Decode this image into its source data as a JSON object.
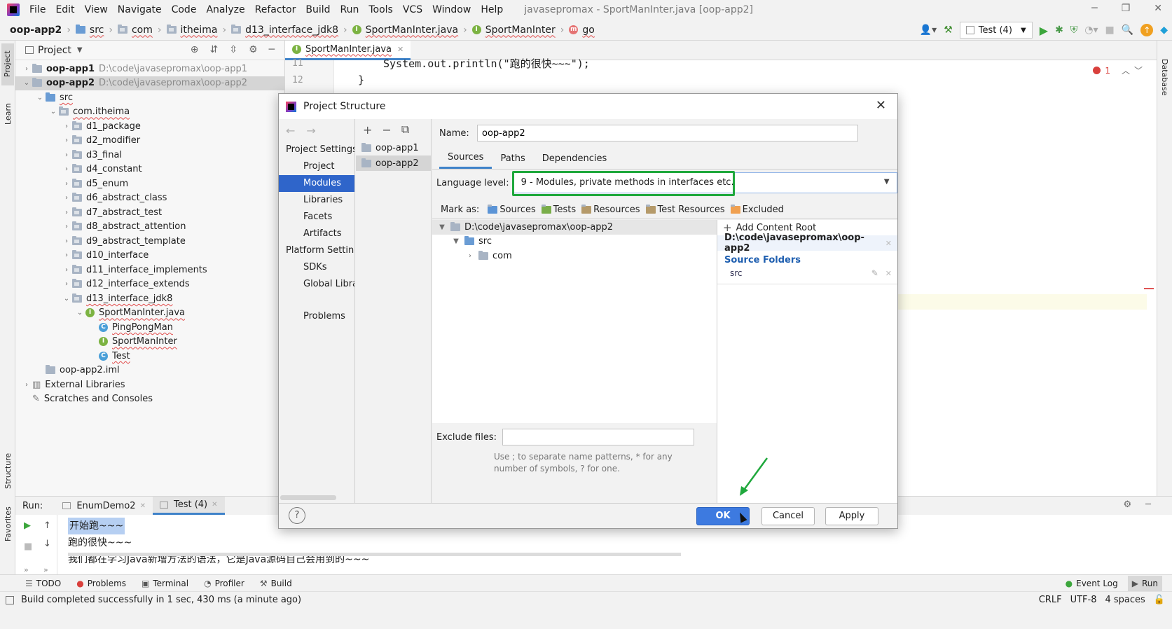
{
  "menubar": {
    "items": [
      "File",
      "Edit",
      "View",
      "Navigate",
      "Code",
      "Analyze",
      "Refactor",
      "Build",
      "Run",
      "Tools",
      "VCS",
      "Window",
      "Help"
    ],
    "title": "javasepromax - SportManInter.java [oop-app2]"
  },
  "navbar": {
    "crumbs": [
      "oop-app2",
      "src",
      "com",
      "itheima",
      "d13_interface_jdk8",
      "SportManInter.java",
      "SportManInter",
      "go"
    ],
    "run_config": "Test (4)"
  },
  "project_panel": {
    "title": "Project",
    "items": [
      {
        "label": "oop-app1",
        "path": "D:\\code\\javasepromax\\oop-app1"
      },
      {
        "label": "oop-app2",
        "path": "D:\\code\\javasepromax\\oop-app2"
      },
      {
        "label": "src"
      },
      {
        "label": "com.itheima"
      },
      {
        "label": "d1_package"
      },
      {
        "label": "d2_modifier"
      },
      {
        "label": "d3_final"
      },
      {
        "label": "d4_constant"
      },
      {
        "label": "d5_enum"
      },
      {
        "label": "d6_abstract_class"
      },
      {
        "label": "d7_abstract_test"
      },
      {
        "label": "d8_abstract_attention"
      },
      {
        "label": "d9_abstract_template"
      },
      {
        "label": "d10_interface"
      },
      {
        "label": "d11_interface_implements"
      },
      {
        "label": "d12_interface_extends"
      },
      {
        "label": "d13_interface_jdk8"
      },
      {
        "label": "SportManInter.java"
      },
      {
        "label": "PingPongMan"
      },
      {
        "label": "SportManInter"
      },
      {
        "label": "Test"
      },
      {
        "label": "oop-app2.iml"
      },
      {
        "label": "External Libraries"
      },
      {
        "label": "Scratches and Consoles"
      }
    ]
  },
  "editor": {
    "tab": "SportManInter.java",
    "lines": [
      {
        "num": "11",
        "code": "System.out.println(\"跑的很快~~~\");"
      },
      {
        "num": "12",
        "code": "}"
      }
    ],
    "errors": "1"
  },
  "left_strip": {
    "project": "Project",
    "learn": "Learn",
    "structure": "Structure",
    "favorites": "Favorites"
  },
  "right_strip": {
    "database": "Database"
  },
  "dialog": {
    "title": "Project Structure",
    "nav_sections": [
      {
        "header": "Project Settings",
        "items": [
          "Project",
          "Modules",
          "Libraries",
          "Facets",
          "Artifacts"
        ]
      },
      {
        "header": "Platform Settings",
        "items": [
          "SDKs",
          "Global Libraries"
        ]
      }
    ],
    "problems": "Problems",
    "modules": [
      "oop-app1",
      "oop-app2"
    ],
    "name_label": "Name:",
    "name_value": "oop-app2",
    "tabs": [
      "Sources",
      "Paths",
      "Dependencies"
    ],
    "language_label": "Language level:",
    "language_value": "9 - Modules, private methods in interfaces etc.",
    "mark_as": "Mark as:",
    "marks": [
      "Sources",
      "Tests",
      "Resources",
      "Test Resources",
      "Excluded"
    ],
    "tree": [
      "D:\\code\\javasepromax\\oop-app2",
      "src",
      "com"
    ],
    "add_content_root": "Add Content Root",
    "content_root": "D:\\code\\javasepromax\\oop-app2",
    "source_folders": "Source Folders",
    "source_folder_item": "src",
    "exclude_label": "Exclude files:",
    "exclude_hint": "Use ; to separate name patterns, * for any number of symbols, ? for one.",
    "ok": "OK",
    "cancel": "Cancel",
    "apply": "Apply",
    "help": "?"
  },
  "run_panel": {
    "label": "Run:",
    "tabs": [
      "EnumDemo2",
      "Test (4)"
    ],
    "output": [
      "开始跑~~~",
      "跑的很快~~~",
      "我们都在学习Java新增方法的语法，它是Java源码自己会用到的~~~"
    ]
  },
  "bottom_tools": [
    "TODO",
    "Problems",
    "Terminal",
    "Profiler",
    "Build"
  ],
  "bottom_right_tools": [
    "Event Log",
    "Run"
  ],
  "status": {
    "message": "Build completed successfully in 1 sec, 430 ms (a minute ago)",
    "line_sep": "CRLF",
    "encoding": "UTF-8",
    "indent": "4 spaces"
  },
  "colors": {
    "accent": "#2f65ca",
    "highlight_box": "#1fa83c",
    "ok_button": "#3d7ae0"
  }
}
